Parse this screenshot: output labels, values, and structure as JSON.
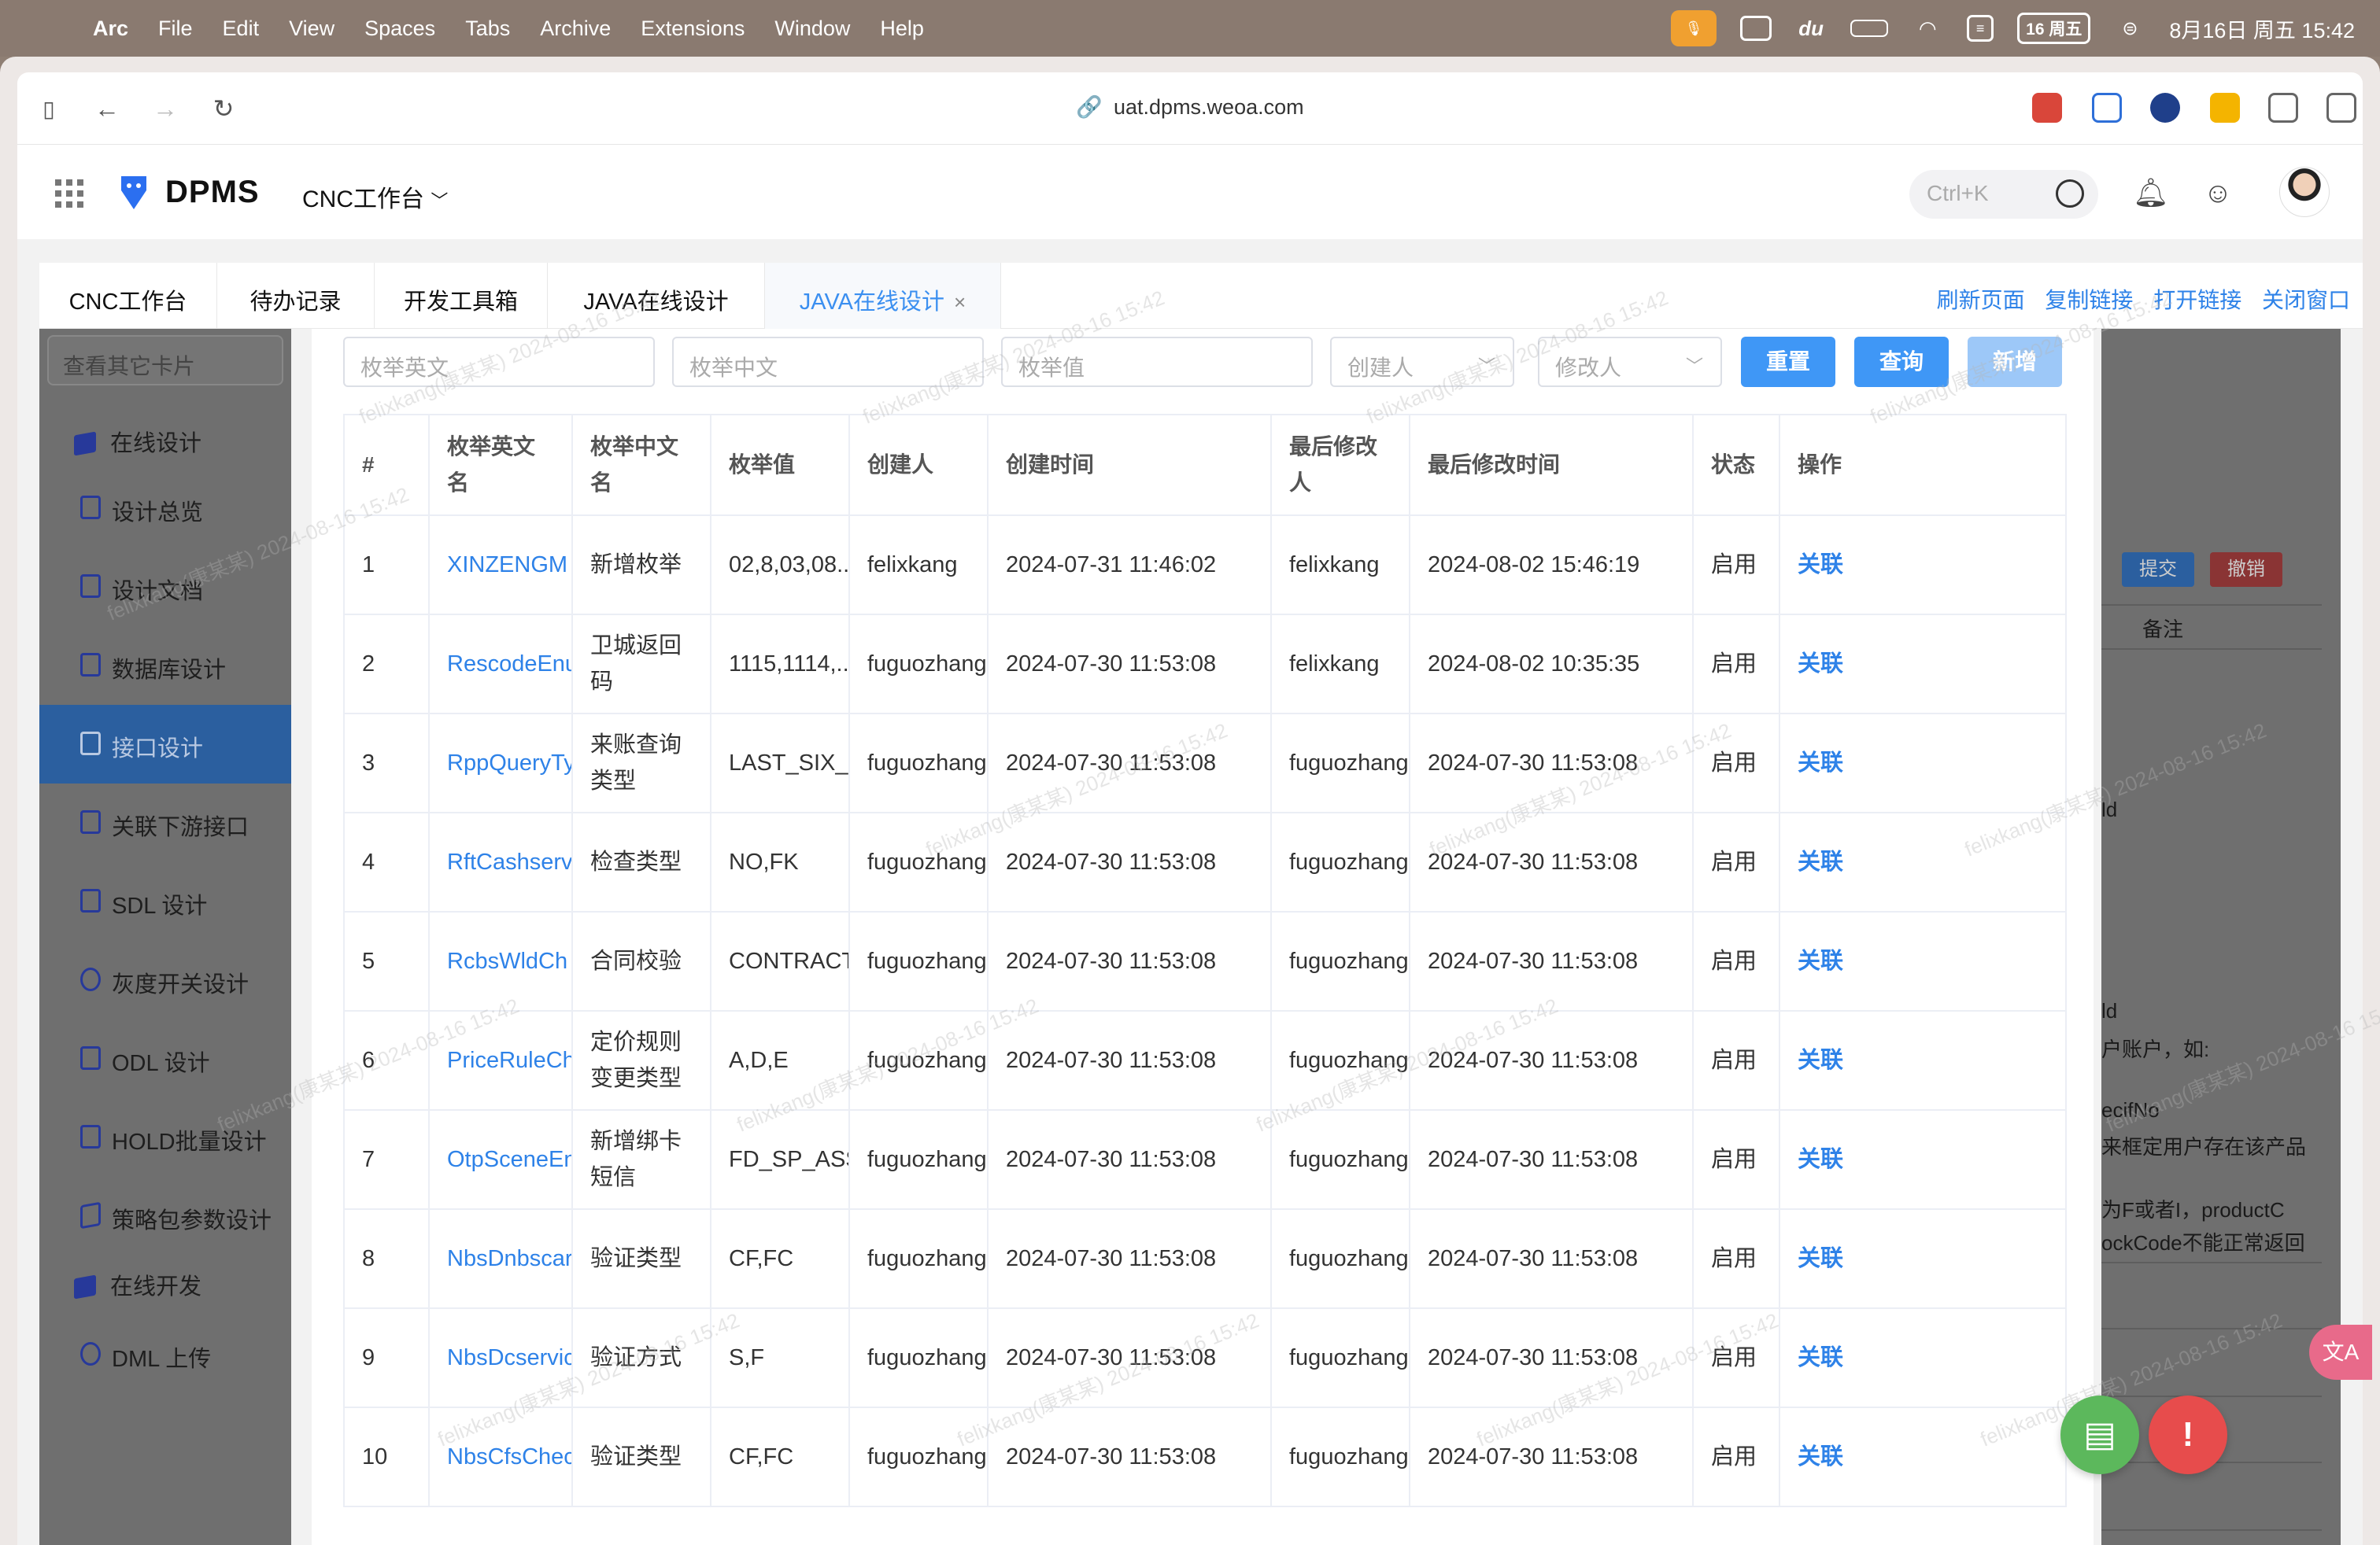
{
  "menubar": {
    "app": "Arc",
    "items": [
      "File",
      "Edit",
      "View",
      "Spaces",
      "Tabs",
      "Archive",
      "Extensions",
      "Window",
      "Help"
    ],
    "date_badge": "16 周五",
    "clock": "8月16日 周五 15:42"
  },
  "browser": {
    "url": "uat.dpms.weoa.com"
  },
  "header": {
    "logo": "DPMS",
    "workspace": "CNC工作台",
    "search_placeholder": "Ctrl+K"
  },
  "tabs": [
    {
      "label": "CNC工作台"
    },
    {
      "label": "待办记录"
    },
    {
      "label": "开发工具箱"
    },
    {
      "label": "JAVA在线设计"
    },
    {
      "label": "JAVA在线设计"
    }
  ],
  "tab_actions": [
    "刷新页面",
    "复制链接",
    "打开链接",
    "关闭窗口"
  ],
  "sidebar": {
    "search_placeholder": "查看其它卡片",
    "group1": "在线设计",
    "items": [
      "设计总览",
      "设计文档",
      "数据库设计",
      "接口设计",
      "关联下游接口",
      "SDL 设计",
      "灰度开关设计",
      "ODL 设计",
      "HOLD批量设计",
      "策略包参数设计"
    ],
    "group2": "在线开发",
    "item_dml": "DML 上传"
  },
  "right_panel": {
    "submit": "提交",
    "revoke": "撤销",
    "remark": "备注",
    "lines": [
      "ld",
      "ld",
      "户账户，如:",
      "ecifNo",
      "来框定用户存在该产品",
      "为F或者I，productC",
      "ockCode不能正常返回"
    ]
  },
  "filters": {
    "enum_en": "枚举英文",
    "enum_cn": "枚举中文",
    "enum_value": "枚举值",
    "creator": "创建人",
    "modifier": "修改人",
    "reset": "重置",
    "query": "查询",
    "add": "新增"
  },
  "table": {
    "headers": [
      "#",
      "枚举英文名",
      "枚举中文名",
      "枚举值",
      "创建人",
      "创建时间",
      "最后修改人",
      "最后修改时间",
      "状态",
      "操作"
    ],
    "rows": [
      [
        "1",
        "XINZENGM",
        "新增枚举",
        "02,8,03,08...",
        "felixkang",
        "2024-07-31 11:46:02",
        "felixkang",
        "2024-08-02 15:46:19",
        "启用",
        "关联"
      ],
      [
        "2",
        "RescodeEnu",
        "卫城返回码",
        "1115,1114,...",
        "fuguozhang",
        "2024-07-30 11:53:08",
        "felixkang",
        "2024-08-02 10:35:35",
        "启用",
        "关联"
      ],
      [
        "3",
        "RppQueryTy",
        "来账查询类型",
        "LAST_SIX_M...",
        "fuguozhang",
        "2024-07-30 11:53:08",
        "fuguozhang",
        "2024-07-30 11:53:08",
        "启用",
        "关联"
      ],
      [
        "4",
        "RftCashserv",
        "检查类型",
        "NO,FK",
        "fuguozhang",
        "2024-07-30 11:53:08",
        "fuguozhang",
        "2024-07-30 11:53:08",
        "启用",
        "关联"
      ],
      [
        "5",
        "RcbsWldCh",
        "合同校验",
        "CONTRACT_B...",
        "fuguozhang",
        "2024-07-30 11:53:08",
        "fuguozhang",
        "2024-07-30 11:53:08",
        "启用",
        "关联"
      ],
      [
        "6",
        "PriceRuleCh",
        "定价规则变更类型",
        "A,D,E",
        "fuguozhang",
        "2024-07-30 11:53:08",
        "fuguozhang",
        "2024-07-30 11:53:08",
        "启用",
        "关联"
      ],
      [
        "7",
        "OtpSceneEn",
        "新增绑卡短信",
        "FD_SP_ASSI...",
        "fuguozhang",
        "2024-07-30 11:53:08",
        "fuguozhang",
        "2024-07-30 11:53:08",
        "启用",
        "关联"
      ],
      [
        "8",
        "NbsDnbscar",
        "验证类型",
        "CF,FC",
        "fuguozhang",
        "2024-07-30 11:53:08",
        "fuguozhang",
        "2024-07-30 11:53:08",
        "启用",
        "关联"
      ],
      [
        "9",
        "NbsDcservic",
        "验证方式",
        "S,F",
        "fuguozhang",
        "2024-07-30 11:53:08",
        "fuguozhang",
        "2024-07-30 11:53:08",
        "启用",
        "关联"
      ],
      [
        "10",
        "NbsCfsChec",
        "验证类型",
        "CF,FC",
        "fuguozhang",
        "2024-07-30 11:53:08",
        "fuguozhang",
        "2024-07-30 11:53:08",
        "启用",
        "关联"
      ]
    ]
  },
  "watermark": "felixkang(康某某) 2024-08-16 15:42",
  "colors": {
    "primary": "#3f97f6",
    "link": "#2e82e8",
    "success_fab": "#5cb85c",
    "danger_fab": "#e74c4c"
  }
}
